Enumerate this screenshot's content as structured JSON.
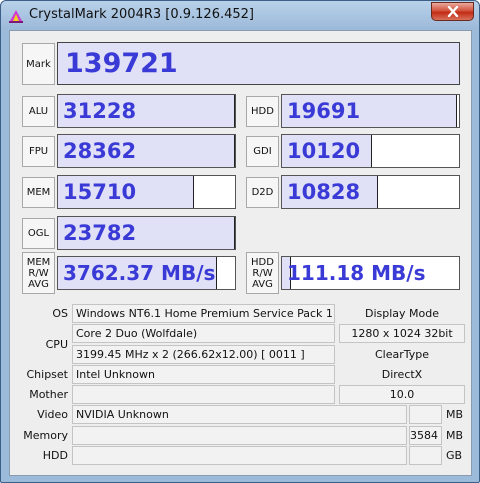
{
  "window": {
    "title": "CrystalMark 2004R3 [0.9.126.452]"
  },
  "scores": {
    "mark": {
      "label": "Mark",
      "value": "139721"
    },
    "alu": {
      "label": "ALU",
      "value": "31228",
      "fill": 1.0
    },
    "fpu": {
      "label": "FPU",
      "value": "28362",
      "fill": 1.0
    },
    "mem": {
      "label": "MEM",
      "value": "15710",
      "fill": 0.77
    },
    "ogl": {
      "label": "OGL",
      "value": "23782",
      "fill": 1.0
    },
    "hdd": {
      "label": "HDD",
      "value": "19691",
      "fill": 0.99
    },
    "gdi": {
      "label": "GDI",
      "value": "10120",
      "fill": 0.51
    },
    "d2d": {
      "label": "D2D",
      "value": "10828",
      "fill": 0.54
    },
    "mem_rw": {
      "label_lines": [
        "MEM",
        "R/W",
        "AVG"
      ],
      "value": "3762.37 MB/s",
      "fill": 0.9
    },
    "hdd_rw": {
      "label_lines": [
        "HDD",
        "R/W",
        "AVG"
      ],
      "value": "111.18 MB/s",
      "fill": 0.05
    }
  },
  "info": {
    "os_label": "OS",
    "os_value": "Windows NT6.1 Home Premium Service Pack 1",
    "cpu_label": "CPU",
    "cpu_name": "Core 2 Duo (Wolfdale)",
    "cpu_speed": "3199.45 MHz x 2 (266.62x12.00) [ 0011 ]",
    "chipset_label": "Chipset",
    "chipset_value": "Intel Unknown",
    "mother_label": "Mother",
    "mother_value": "",
    "video_label": "Video",
    "video_value": "NVIDIA Unknown",
    "video_mem": "",
    "video_unit": "MB",
    "memory_label": "Memory",
    "memory_value": "",
    "memory_size": "3584",
    "memory_unit": "MB",
    "hdd_label": "HDD",
    "hdd_value": "",
    "hdd_size": "",
    "hdd_unit": "GB",
    "display_mode_label": "Display Mode",
    "display_mode_value": "1280 x 1024 32bit",
    "cleartype": "ClearType",
    "directx_label": "DirectX",
    "directx_value": "10.0"
  },
  "colors": {
    "score_text": "#3a3ad6",
    "bar_fill": "#e0e0f6"
  }
}
